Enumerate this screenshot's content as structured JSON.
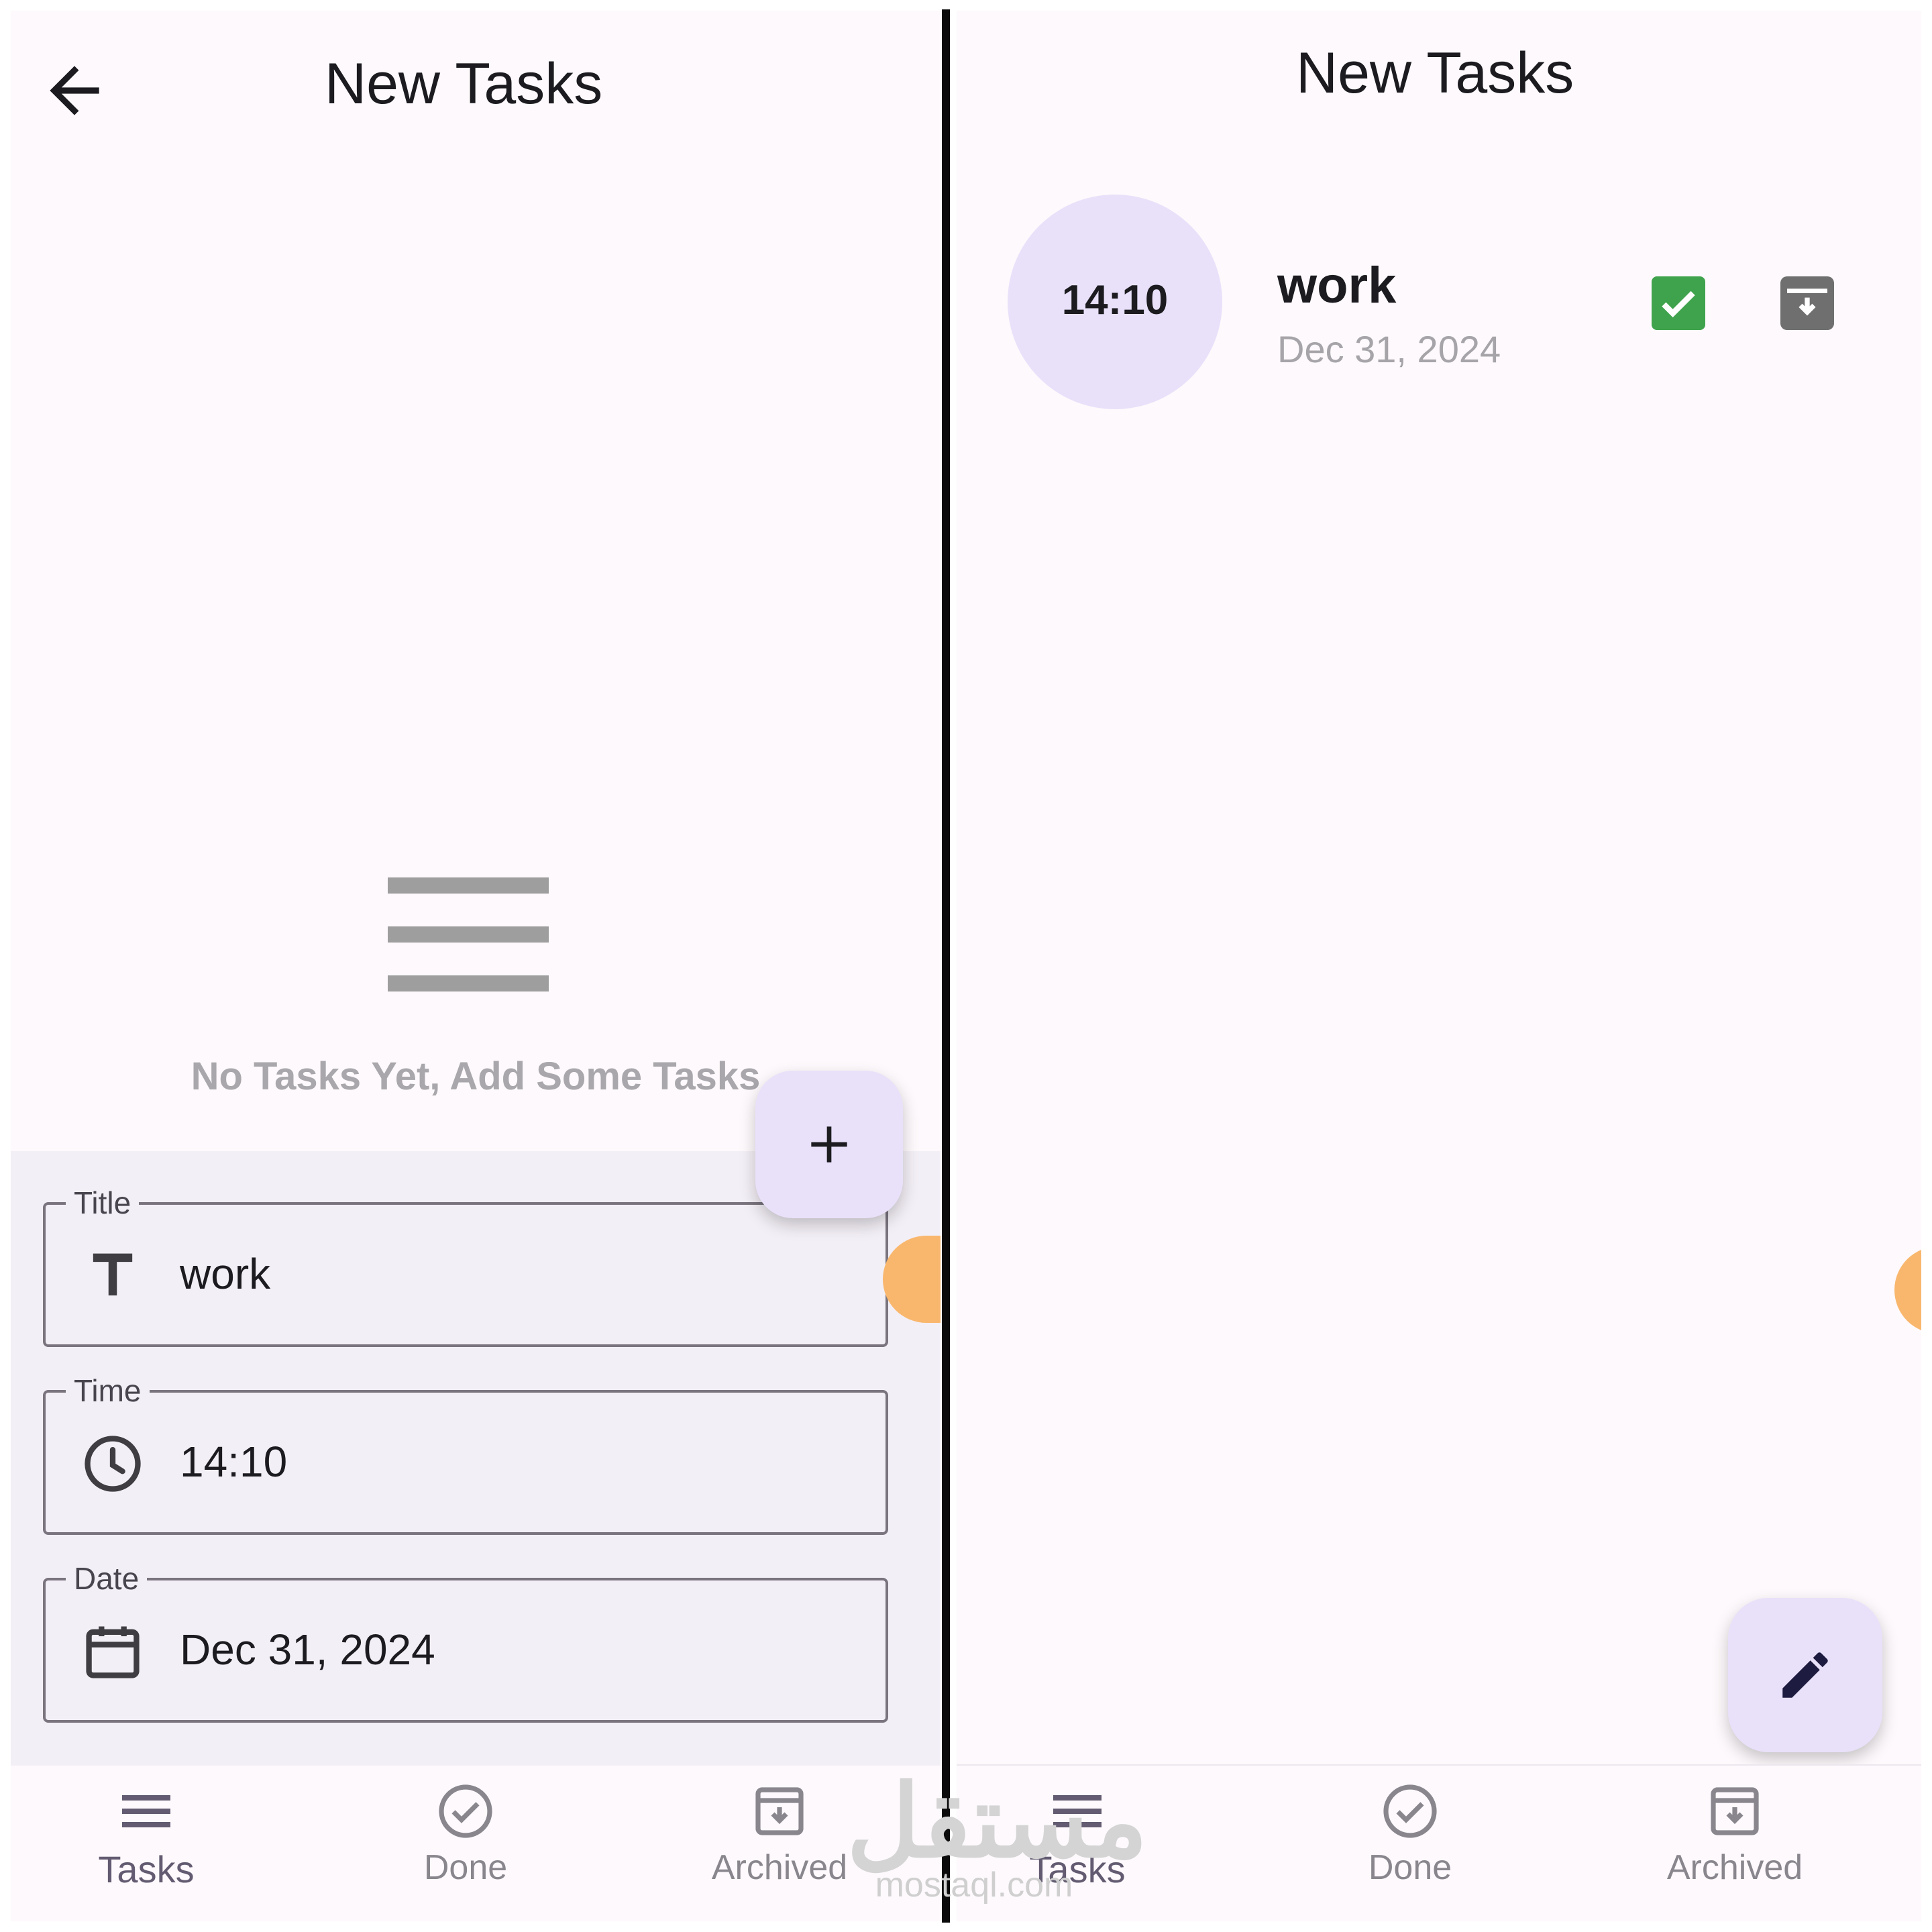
{
  "left": {
    "app_bar": {
      "title": "New Tasks",
      "back_icon": "arrow-left-icon"
    },
    "empty_state": {
      "icon": "menu-icon",
      "message": "No Tasks Yet, Add Some Tasks"
    },
    "form": {
      "title_field": {
        "label": "Title",
        "value": "work",
        "icon": "text-t-icon"
      },
      "time_field": {
        "label": "Time",
        "value": "14:10",
        "icon": "clock-icon"
      },
      "date_field": {
        "label": "Date",
        "value": "Dec 31, 2024",
        "icon": "calendar-icon"
      }
    },
    "fab": {
      "icon": "plus-icon"
    },
    "nav": [
      {
        "label": "Tasks",
        "icon": "menu-icon",
        "active": true
      },
      {
        "label": "Done",
        "icon": "check-circle-icon",
        "active": false
      },
      {
        "label": "Archived",
        "icon": "archive-icon",
        "active": false
      }
    ]
  },
  "right": {
    "app_bar": {
      "title": "New Tasks"
    },
    "task": {
      "time": "14:10",
      "title": "work",
      "date": "Dec 31, 2024",
      "done_icon": "checkbox-checked-icon",
      "archive_icon": "archive-icon"
    },
    "fab": {
      "icon": "edit-icon"
    },
    "nav": [
      {
        "label": "Tasks",
        "icon": "menu-icon",
        "active": true
      },
      {
        "label": "Done",
        "icon": "check-circle-icon",
        "active": false
      },
      {
        "label": "Archived",
        "icon": "archive-icon",
        "active": false
      }
    ]
  },
  "watermark": {
    "logo": "مستقل",
    "url": "mostaql.com"
  },
  "colors": {
    "background": "#fdf9fc",
    "accent_container": "#e9e1fa",
    "sheet": "#f3eff6",
    "check_green": "#3fa34d",
    "orange_bubble": "#f9b76d"
  }
}
